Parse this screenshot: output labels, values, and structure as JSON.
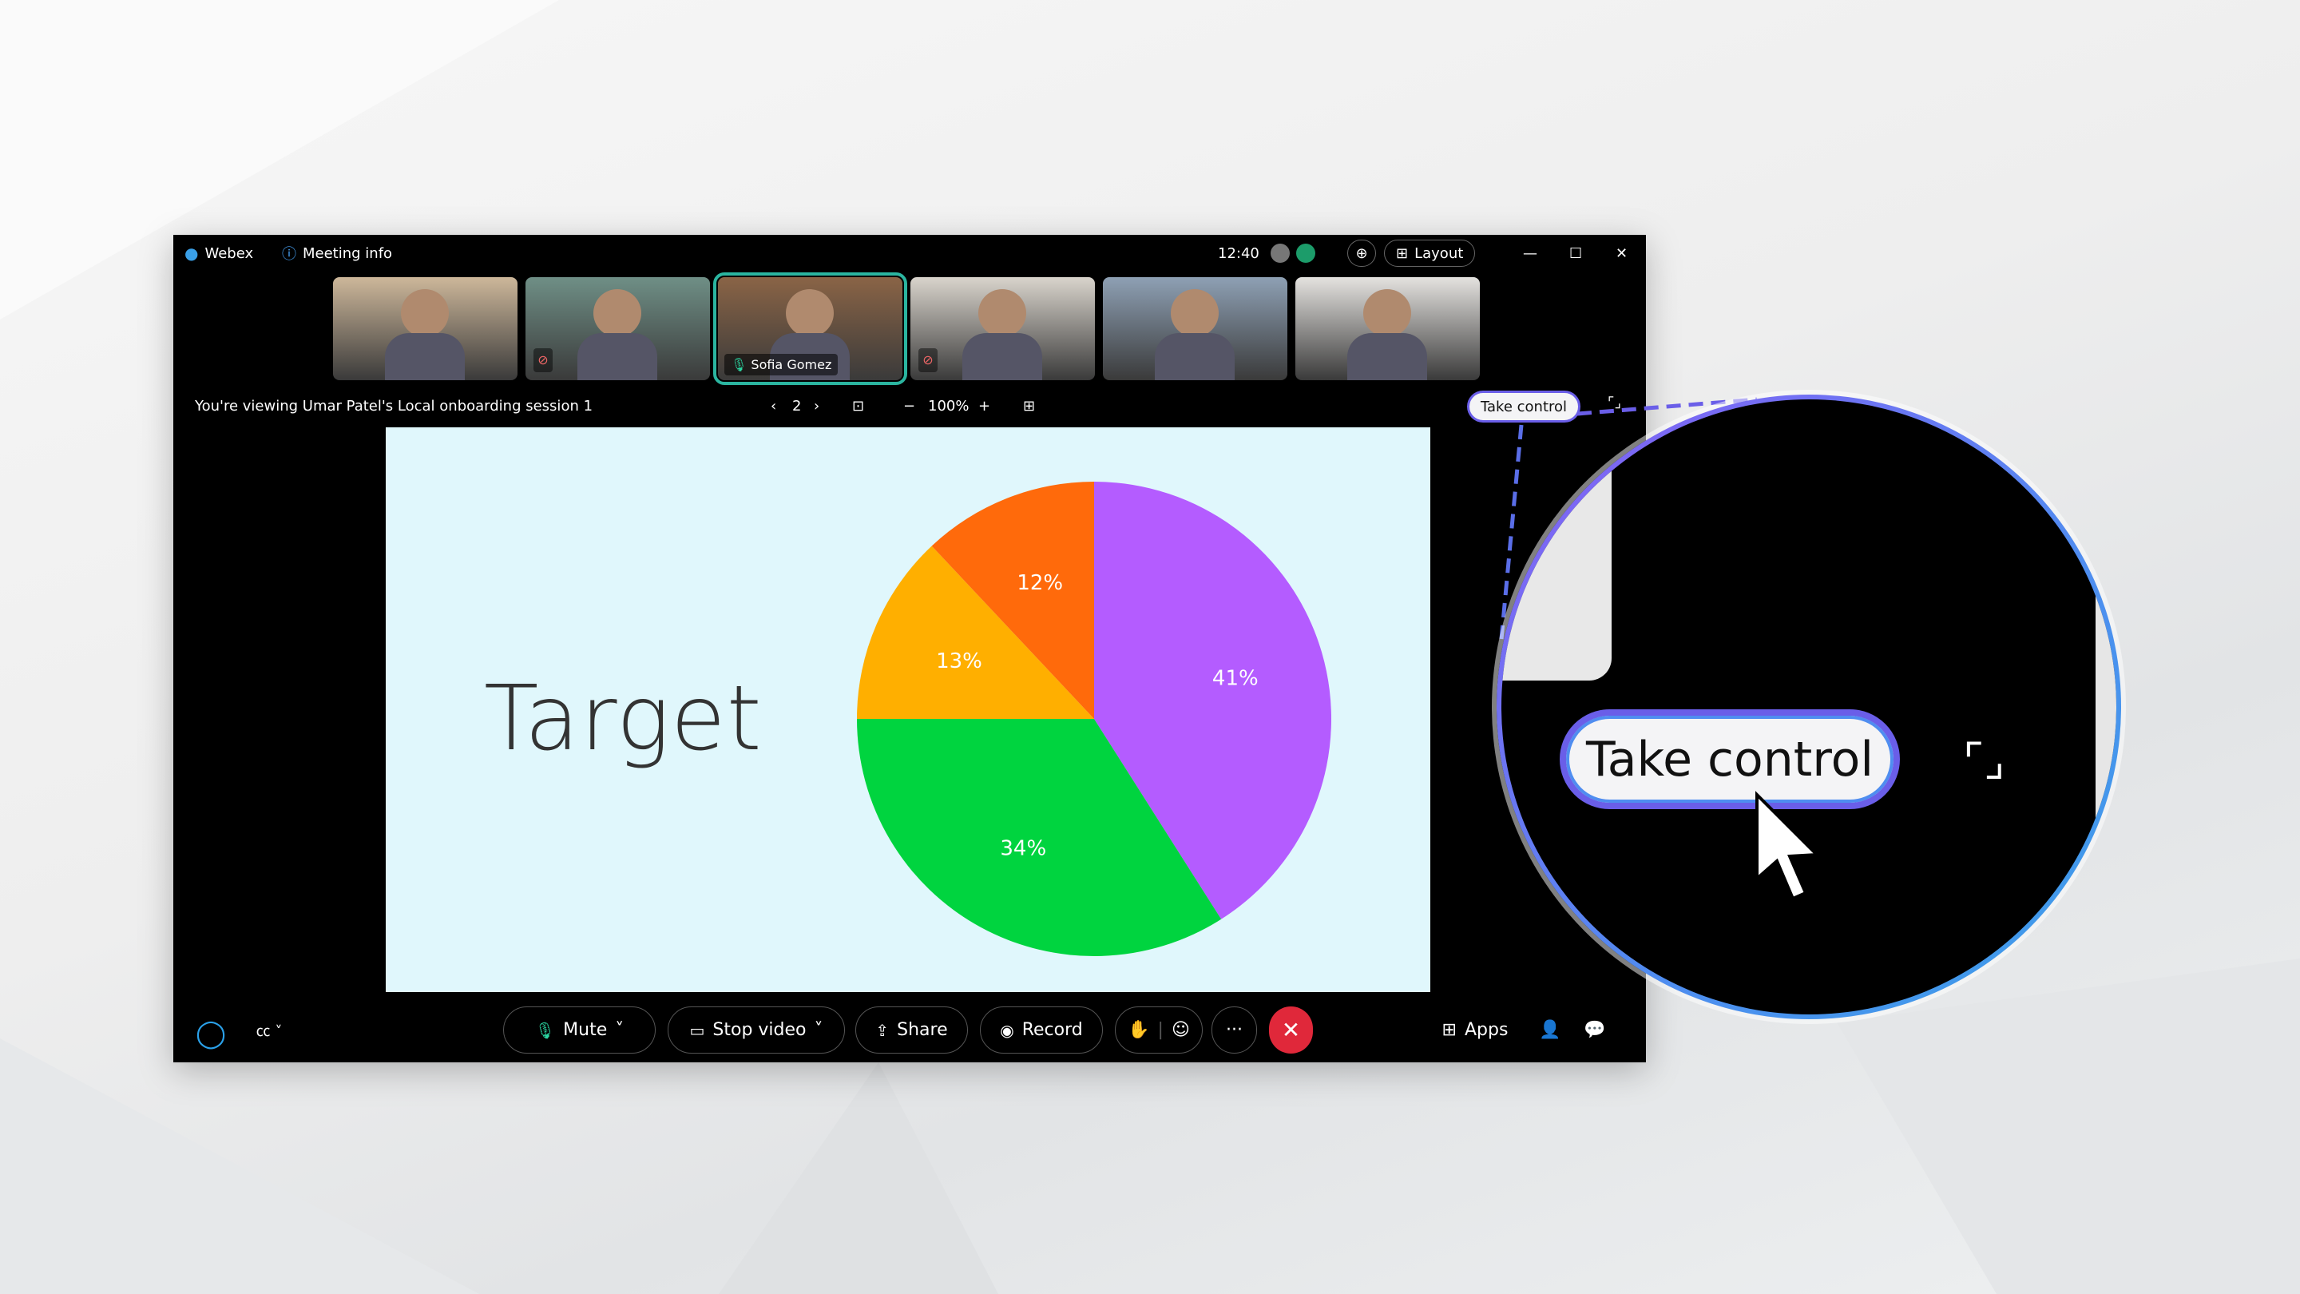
{
  "titlebar": {
    "app": "Webex",
    "meeting_info": "Meeting info",
    "time": "12:40",
    "layout": "Layout"
  },
  "participants": [
    {
      "name": "",
      "muted": false,
      "bg": "#cdb79a"
    },
    {
      "name": "",
      "muted": true,
      "bg": "#6f8f86"
    },
    {
      "name": "Sofia Gomez",
      "muted": false,
      "active": true,
      "bg": "#8a6446"
    },
    {
      "name": "",
      "muted": true,
      "bg": "#d9d4cc"
    },
    {
      "name": "",
      "muted": false,
      "bg": "#8ea0b4"
    },
    {
      "name": "",
      "muted": false,
      "bg": "#e4e2df"
    }
  ],
  "share_bar": {
    "viewing": "You're viewing Umar Patel's Local onboarding session 1",
    "page": "2",
    "zoom": "100%",
    "take_control": "Take control"
  },
  "slide": {
    "title": "Target"
  },
  "chart_data": {
    "type": "pie",
    "slices": [
      {
        "label": "41%",
        "value": 41,
        "color": "#b45cff"
      },
      {
        "label": "34%",
        "value": 34,
        "color": "#00d43f"
      },
      {
        "label": "13%",
        "value": 13,
        "color": "#ffaf00"
      },
      {
        "label": "12%",
        "value": 12,
        "color": "#ff6a0b"
      }
    ]
  },
  "toolbar": {
    "mute": "Mute",
    "stop_video": "Stop video",
    "share": "Share",
    "record": "Record",
    "more": "···",
    "apps": "Apps"
  },
  "magnifier": {
    "take_control": "Take control"
  },
  "colors": {
    "accent": "#6a5ee8",
    "end_call": "#e0283a",
    "active_speaker": "#2bb5a0"
  }
}
